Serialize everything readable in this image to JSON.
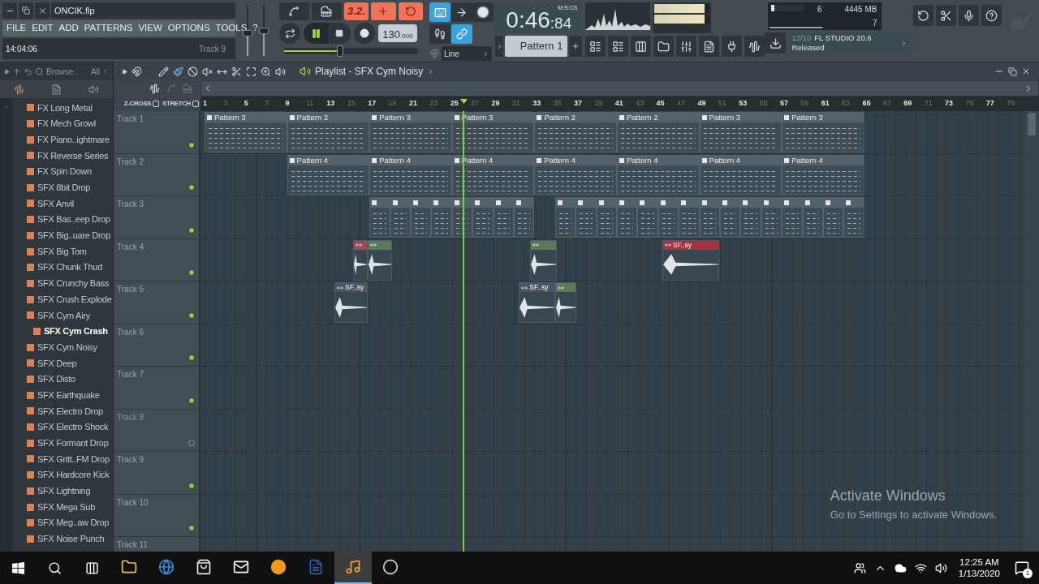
{
  "window": {
    "title": "ONCIK.flp"
  },
  "menu": [
    "FILE",
    "EDIT",
    "ADD",
    "PATTERNS",
    "VIEW",
    "OPTIONS",
    "TOOLS",
    "?"
  ],
  "hint_bar": {
    "time": "14:04:06",
    "target": "Track 9"
  },
  "mixer_sliders": [
    {
      "level": 0.45
    },
    {
      "level": 0.5
    }
  ],
  "song_buttons": [
    {
      "kind": "countdown",
      "label": "3.2.",
      "on": true
    },
    {
      "kind": "step-edit",
      "on": true
    },
    {
      "kind": "loop-record",
      "on": true
    }
  ],
  "transport": {
    "playing": true,
    "recording": false,
    "tempo": "130",
    "tempo_decimals": ".000",
    "volume": {
      "level": 0.42
    }
  },
  "toggles": [
    {
      "kind": "keyboard",
      "on": true
    },
    {
      "kind": "arrow",
      "on": false
    },
    {
      "kind": "step",
      "on": false
    },
    {
      "kind": "link",
      "on": true
    }
  ],
  "snap": "Line",
  "time": {
    "main": "0:46",
    "sub": ":84",
    "format": "M:S:CS"
  },
  "pattern": "Pattern 1",
  "peak_meter": [
    {
      "level": 0.9
    },
    {
      "level": 0.9
    }
  ],
  "cpu": {
    "value": "6",
    "level": 0.04
  },
  "memory": {
    "value": "4445 MB",
    "level": 0.95
  },
  "polyphony": "7",
  "news": {
    "date": "12/10",
    "title": "FL STUDIO 20.6",
    "subtitle": "Released"
  },
  "browser": {
    "title": "Browse..",
    "filter": "All",
    "items": [
      {
        "label": "FX Long Metal",
        "selected": false
      },
      {
        "label": "FX Mech Growl",
        "selected": false
      },
      {
        "label": "FX Piano..ightmare",
        "selected": false
      },
      {
        "label": "FX Reverse Series",
        "selected": false
      },
      {
        "label": "FX Spin Down",
        "selected": false
      },
      {
        "label": "SFX 8bit Drop",
        "selected": false
      },
      {
        "label": "SFX Anvil",
        "selected": false
      },
      {
        "label": "SFX Bas..eep Drop",
        "selected": false
      },
      {
        "label": "SFX Big..uare Drop",
        "selected": false
      },
      {
        "label": "SFX Big Tom",
        "selected": false
      },
      {
        "label": "SFX Chunk Thud",
        "selected": false
      },
      {
        "label": "SFX Crunchy Bass",
        "selected": false
      },
      {
        "label": "SFX Crush Explode",
        "selected": false
      },
      {
        "label": "SFX Cym Airy",
        "selected": false
      },
      {
        "label": "SFX Cym Crash",
        "selected": true
      },
      {
        "label": "SFX Cym Noisy",
        "selected": false
      },
      {
        "label": "SFX Deep",
        "selected": false
      },
      {
        "label": "SFX Disto",
        "selected": false
      },
      {
        "label": "SFX Earthquake",
        "selected": false
      },
      {
        "label": "SFX Electro Drop",
        "selected": false
      },
      {
        "label": "SFX Electro Shock",
        "selected": false
      },
      {
        "label": "SFX Formant Drop",
        "selected": false
      },
      {
        "label": "SFX Gritt..FM Drop",
        "selected": false
      },
      {
        "label": "SFX Hardcore Kick",
        "selected": false
      },
      {
        "label": "SFX Lightning",
        "selected": false
      },
      {
        "label": "SFX Mega Sub",
        "selected": false
      },
      {
        "label": "SFX Meg..aw Drop",
        "selected": false
      },
      {
        "label": "SFX Noise Punch",
        "selected": false
      }
    ]
  },
  "playlist": {
    "title": "Playlist - SFX Cym Noisy",
    "options": [
      {
        "label": "Z-CROSS",
        "checked": false
      },
      {
        "label": "STRETCH",
        "checked": false
      }
    ],
    "ruler": [
      "1",
      "3",
      "5",
      "7",
      "9",
      "11",
      "13",
      "15",
      "17",
      "19",
      "21",
      "23",
      "25",
      "27",
      "29",
      "31",
      "33",
      "35",
      "37",
      "39",
      "41",
      "43",
      "45",
      "47",
      "49",
      "51",
      "53",
      "55",
      "57",
      "59",
      "61",
      "63",
      "65",
      "67",
      "69",
      "71",
      "73",
      "75",
      "77",
      "79"
    ],
    "tracks": [
      {
        "name": "Track 1",
        "muted": false,
        "clips": [
          {
            "kind": "pattern",
            "label": "Pattern 3"
          },
          {
            "kind": "pattern",
            "label": "Pattern 3"
          },
          {
            "kind": "pattern",
            "label": "Pattern 3"
          },
          {
            "kind": "pattern",
            "label": "Pattern 3"
          },
          {
            "kind": "pattern",
            "label": "Pattern 2"
          },
          {
            "kind": "pattern",
            "label": "Pattern 2"
          },
          {
            "kind": "pattern",
            "label": "Pattern 3"
          },
          {
            "kind": "pattern",
            "label": "Pattern 3"
          }
        ]
      },
      {
        "name": "Track 2",
        "muted": false,
        "clips": [
          {
            "kind": "pattern",
            "label": "Pattern 4"
          },
          {
            "kind": "pattern",
            "label": "Pattern 4"
          },
          {
            "kind": "pattern",
            "label": "Pattern 4"
          },
          {
            "kind": "pattern",
            "label": "Pattern 4"
          },
          {
            "kind": "pattern",
            "label": "Pattern 4"
          },
          {
            "kind": "pattern",
            "label": "Pattern 4"
          },
          {
            "kind": "pattern",
            "label": "Pattern 4"
          }
        ]
      },
      {
        "name": "Track 3",
        "muted": false,
        "clips": [
          {
            "kind": "pattern"
          },
          {
            "kind": "pattern"
          },
          {
            "kind": "pattern"
          },
          {
            "kind": "pattern"
          },
          {
            "kind": "pattern"
          },
          {
            "kind": "pattern"
          },
          {
            "kind": "pattern"
          },
          {
            "kind": "pattern"
          },
          {
            "kind": "pattern"
          },
          {
            "kind": "pattern"
          },
          {
            "kind": "pattern"
          },
          {
            "kind": "pattern"
          },
          {
            "kind": "pattern"
          },
          {
            "kind": "pattern"
          },
          {
            "kind": "pattern"
          },
          {
            "kind": "pattern"
          },
          {
            "kind": "pattern"
          },
          {
            "kind": "pattern"
          },
          {
            "kind": "pattern"
          },
          {
            "kind": "pattern"
          },
          {
            "kind": "pattern"
          },
          {
            "kind": "pattern"
          },
          {
            "kind": "pattern"
          }
        ]
      },
      {
        "name": "Track 4",
        "muted": false,
        "clips": [
          {
            "kind": "audio",
            "color": "#9c4a5a"
          },
          {
            "kind": "audio",
            "color": "#5d7a58"
          },
          {
            "kind": "audio",
            "color": "#5d7a58"
          },
          {
            "kind": "audio",
            "label": "SF..sy",
            "color": "#a8323c"
          }
        ]
      },
      {
        "name": "Track 5",
        "muted": false,
        "clips": [
          {
            "kind": "audio",
            "label": "SF..sy",
            "color": "#4b5469"
          },
          {
            "kind": "audio",
            "label": "SF..sy",
            "color": "#4b5469"
          },
          {
            "kind": "audio",
            "color": "#5d7a58"
          }
        ]
      },
      {
        "name": "Track 6",
        "muted": false
      },
      {
        "name": "Track 7",
        "muted": false
      },
      {
        "name": "Track 8",
        "muted": true
      },
      {
        "name": "Track 9",
        "muted": false
      },
      {
        "name": "Track 10",
        "muted": false
      },
      {
        "name": "Track 11"
      }
    ]
  },
  "activation": {
    "title": "Activate Windows",
    "body": "Go to Settings to activate Windows."
  },
  "taskbar": {
    "apps": [
      {
        "kind": "explorer",
        "active": false
      },
      {
        "kind": "edge",
        "active": false
      },
      {
        "kind": "store",
        "active": false
      },
      {
        "kind": "mail",
        "active": false
      },
      {
        "kind": "browser",
        "active": false
      },
      {
        "kind": "word",
        "active": false
      },
      {
        "kind": "fl",
        "active": true
      },
      {
        "kind": "obs",
        "active": false
      }
    ],
    "time": "12:25 AM",
    "date": "1/13/2020",
    "notifications": "1"
  }
}
